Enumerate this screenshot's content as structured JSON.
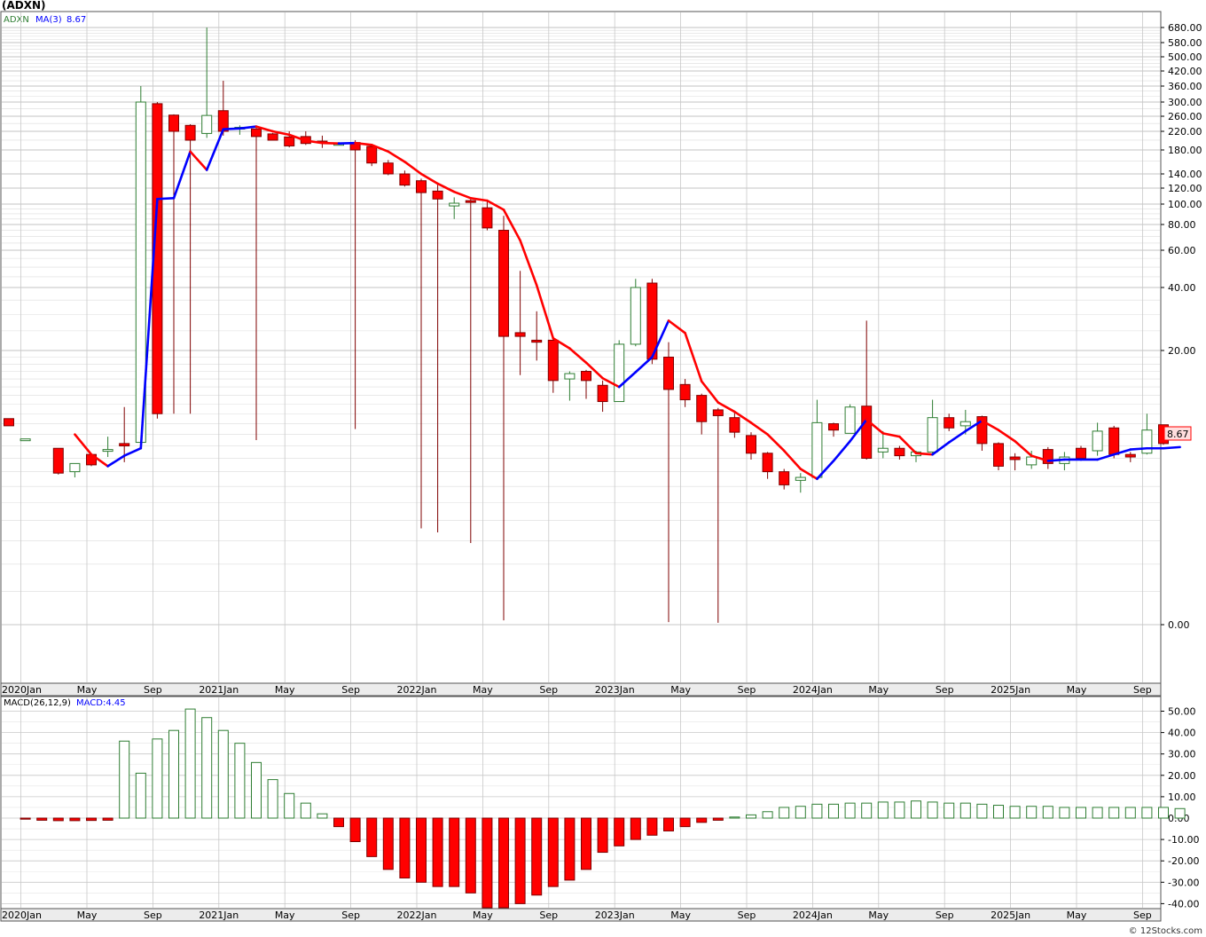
{
  "header": {
    "title": "(ADXN)",
    "legend_symbol": "ADXN",
    "legend_ma": "MA(3)",
    "legend_ma_value": "8.67",
    "last_price_label": "8.67",
    "macd_label": "MACD(26,12,9)",
    "macd_value_label": "MACD:4.45",
    "footer": "© 12Stocks.com"
  },
  "colors": {
    "up": "#2e7d32",
    "down": "#ff0000",
    "down_outline": "#7f0000",
    "ma_up": "#0000ff",
    "ma_down": "#ff0000",
    "grid": "#c8c8c8",
    "axis_bg": "#ececec"
  },
  "chart_data": [
    {
      "type": "candlestick",
      "title": "(ADXN)",
      "y_scale": "log",
      "y_tick_labels": [
        "680.00",
        "580.00",
        "500.00",
        "420.00",
        "360.00",
        "300.00",
        "260.00",
        "220.00",
        "180.00",
        "140.00",
        "120.00",
        "100.00",
        "80.00",
        "60.00",
        "40.00",
        "20.00",
        "0.00"
      ],
      "x_tick_labels": [
        "2020Jan",
        "May",
        "Sep",
        "2021Jan",
        "May",
        "Sep",
        "2022Jan",
        "May",
        "Sep",
        "2023Jan",
        "May",
        "Sep",
        "2024Jan",
        "May",
        "Sep",
        "2025Jan",
        "May",
        "Sep"
      ],
      "legend": [
        "ADXN",
        "MA(3)"
      ],
      "last_value": 8.67,
      "candles": [
        {
          "t": "2019-12",
          "o": 11.5,
          "h": 11.5,
          "l": 10.8,
          "c": 10.8
        },
        {
          "t": "2020-01",
          "o": 9.6,
          "h": 9.6,
          "l": 9.6,
          "c": 9.6
        },
        {
          "t": "2020-03",
          "o": 8.8,
          "h": 8.8,
          "l": 6.8,
          "c": 6.9
        },
        {
          "t": "2020-04",
          "o": 7.0,
          "h": 7.5,
          "l": 6.6,
          "c": 7.6
        },
        {
          "t": "2020-05",
          "o": 8.3,
          "h": 8.4,
          "l": 7.4,
          "c": 7.5
        },
        {
          "t": "2020-06",
          "o": 8.6,
          "h": 9.8,
          "l": 8.1,
          "c": 8.7
        },
        {
          "t": "2020-07",
          "o": 9.2,
          "h": 12.7,
          "l": 7.7,
          "c": 9.0
        },
        {
          "t": "2020-08",
          "o": 9.3,
          "h": 360,
          "l": 9.3,
          "c": 300
        },
        {
          "t": "2020-09",
          "o": 295,
          "h": 300,
          "l": 11.5,
          "c": 12.0
        },
        {
          "t": "2020-10",
          "o": 263,
          "h": 265,
          "l": 12.0,
          "c": 220
        },
        {
          "t": "2020-11",
          "o": 235,
          "h": 238,
          "l": 12.0,
          "c": 200
        },
        {
          "t": "2020-12",
          "o": 215,
          "h": 690,
          "l": 205,
          "c": 262
        },
        {
          "t": "2021-01",
          "o": 275,
          "h": 380,
          "l": 210,
          "c": 220
        },
        {
          "t": "2021-02",
          "o": 228,
          "h": 235,
          "l": 212,
          "c": 230
        },
        {
          "t": "2021-03",
          "o": 226,
          "h": 230,
          "l": 9.5,
          "c": 208
        },
        {
          "t": "2021-04",
          "o": 214,
          "h": 216,
          "l": 200,
          "c": 200
        },
        {
          "t": "2021-05",
          "o": 207,
          "h": 220,
          "l": 185,
          "c": 188
        },
        {
          "t": "2021-06",
          "o": 208,
          "h": 220,
          "l": 190,
          "c": 193
        },
        {
          "t": "2021-07",
          "o": 198,
          "h": 210,
          "l": 184,
          "c": 197
        },
        {
          "t": "2021-08",
          "o": 193,
          "h": 196,
          "l": 189,
          "c": 193
        },
        {
          "t": "2021-09",
          "o": 195,
          "h": 200,
          "l": 10.5,
          "c": 180
        },
        {
          "t": "2021-10",
          "o": 187,
          "h": 190,
          "l": 152,
          "c": 157
        },
        {
          "t": "2021-11",
          "o": 157,
          "h": 162,
          "l": 138,
          "c": 140
        },
        {
          "t": "2021-12",
          "o": 140,
          "h": 145,
          "l": 122,
          "c": 124
        },
        {
          "t": "2022-01",
          "o": 130,
          "h": 133,
          "l": 3.6,
          "c": 114
        },
        {
          "t": "2022-02",
          "o": 116,
          "h": 125,
          "l": 3.4,
          "c": 106
        },
        {
          "t": "2022-03",
          "o": 98,
          "h": 108,
          "l": 85,
          "c": 101
        },
        {
          "t": "2022-04",
          "o": 104,
          "h": 107,
          "l": 2.9,
          "c": 103
        },
        {
          "t": "2022-05",
          "o": 96,
          "h": 104,
          "l": 75,
          "c": 77
        },
        {
          "t": "2022-06",
          "o": 75,
          "h": 88,
          "l": 0.12,
          "c": 23.5
        },
        {
          "t": "2022-07",
          "o": 24.5,
          "h": 48,
          "l": 16.5,
          "c": 23.5
        },
        {
          "t": "2022-08",
          "o": 22.5,
          "h": 31,
          "l": 18.5,
          "c": 22.0
        },
        {
          "t": "2022-09",
          "o": 22.5,
          "h": 23.5,
          "l": 14.3,
          "c": 15.8
        },
        {
          "t": "2022-10",
          "o": 16.0,
          "h": 17.0,
          "l": 13.4,
          "c": 16.7
        },
        {
          "t": "2022-11",
          "o": 17.0,
          "h": 17.2,
          "l": 13.6,
          "c": 15.8
        },
        {
          "t": "2022-12",
          "o": 15.2,
          "h": 15.8,
          "l": 12.2,
          "c": 13.3
        },
        {
          "t": "2023-01",
          "o": 13.3,
          "h": 22.5,
          "l": 13.3,
          "c": 21.5
        },
        {
          "t": "2023-02",
          "o": 21.5,
          "h": 44,
          "l": 21.0,
          "c": 40
        },
        {
          "t": "2023-03",
          "o": 42,
          "h": 44,
          "l": 18.0,
          "c": 18.7
        },
        {
          "t": "2023-04",
          "o": 19.0,
          "h": 22,
          "l": 0.07,
          "c": 14.7
        },
        {
          "t": "2023-05",
          "o": 15.3,
          "h": 16.0,
          "l": 12.7,
          "c": 13.5
        },
        {
          "t": "2023-06",
          "o": 14.0,
          "h": 14.2,
          "l": 10.0,
          "c": 11.2
        },
        {
          "t": "2023-07",
          "o": 12.4,
          "h": 12.6,
          "l": 0.05,
          "c": 11.8
        },
        {
          "t": "2023-08",
          "o": 11.6,
          "h": 12.2,
          "l": 9.7,
          "c": 10.2
        },
        {
          "t": "2023-09",
          "o": 9.9,
          "h": 10.2,
          "l": 7.9,
          "c": 8.4
        },
        {
          "t": "2023-10",
          "o": 8.4,
          "h": 8.5,
          "l": 6.5,
          "c": 7.0
        },
        {
          "t": "2023-11",
          "o": 7.0,
          "h": 7.2,
          "l": 5.8,
          "c": 6.1
        },
        {
          "t": "2023-12",
          "o": 6.4,
          "h": 6.9,
          "l": 5.6,
          "c": 6.6
        },
        {
          "t": "2024-01",
          "o": 6.6,
          "h": 13.5,
          "l": 6.6,
          "c": 11.1
        },
        {
          "t": "2024-02",
          "o": 11.0,
          "h": 11.1,
          "l": 9.8,
          "c": 10.4
        },
        {
          "t": "2024-03",
          "o": 10.1,
          "h": 13.0,
          "l": 10.1,
          "c": 12.7
        },
        {
          "t": "2024-04",
          "o": 12.8,
          "h": 28.0,
          "l": 7.9,
          "c": 8.0
        },
        {
          "t": "2024-05",
          "o": 8.5,
          "h": 10.3,
          "l": 8.0,
          "c": 8.8
        },
        {
          "t": "2024-06",
          "o": 8.8,
          "h": 9.0,
          "l": 7.9,
          "c": 8.2
        },
        {
          "t": "2024-07",
          "o": 8.2,
          "h": 8.6,
          "l": 7.7,
          "c": 8.5
        },
        {
          "t": "2024-08",
          "o": 8.5,
          "h": 13.5,
          "l": 8.2,
          "c": 11.6
        },
        {
          "t": "2024-09",
          "o": 11.6,
          "h": 12.0,
          "l": 10.3,
          "c": 10.6
        },
        {
          "t": "2024-10",
          "o": 10.8,
          "h": 12.4,
          "l": 10.0,
          "c": 11.2
        },
        {
          "t": "2024-11",
          "o": 11.7,
          "h": 11.8,
          "l": 8.6,
          "c": 9.2
        },
        {
          "t": "2024-12",
          "o": 9.2,
          "h": 9.3,
          "l": 7.1,
          "c": 7.4
        },
        {
          "t": "2025-01",
          "o": 8.1,
          "h": 8.4,
          "l": 7.1,
          "c": 7.9
        },
        {
          "t": "2025-02",
          "o": 7.5,
          "h": 8.6,
          "l": 7.2,
          "c": 8.1
        },
        {
          "t": "2025-03",
          "o": 8.7,
          "h": 8.9,
          "l": 7.2,
          "c": 7.6
        },
        {
          "t": "2025-04",
          "o": 7.6,
          "h": 8.5,
          "l": 7.1,
          "c": 8.1
        },
        {
          "t": "2025-05",
          "o": 8.8,
          "h": 9.0,
          "l": 7.9,
          "c": 8.0
        },
        {
          "t": "2025-06",
          "o": 8.6,
          "h": 11.1,
          "l": 8.2,
          "c": 10.3
        },
        {
          "t": "2025-07",
          "o": 10.6,
          "h": 10.8,
          "l": 8.0,
          "c": 8.3
        },
        {
          "t": "2025-08",
          "o": 8.3,
          "h": 8.5,
          "l": 7.7,
          "c": 8.1
        },
        {
          "t": "2025-09",
          "o": 8.4,
          "h": 12.0,
          "l": 8.3,
          "c": 10.4
        },
        {
          "t": "2025-10",
          "o": 10.9,
          "h": 10.9,
          "l": 9.1,
          "c": 9.2
        }
      ],
      "ma3": [
        null,
        null,
        10.0,
        8.3,
        7.4,
        8.2,
        8.8,
        106,
        107,
        177,
        146,
        225,
        227,
        232,
        220,
        212,
        199,
        194,
        193,
        194,
        190,
        177,
        159,
        140,
        126,
        115,
        107,
        104,
        94,
        67,
        41,
        23,
        20.5,
        18.2,
        16.1,
        15.0,
        16.9,
        19.0,
        28,
        24.4,
        15.7,
        13.2,
        12.2,
        11.1,
        10.0,
        8.6,
        7.2,
        6.5,
        7.8,
        9.4,
        11.4,
        10.1,
        9.8,
        8.4,
        8.3,
        9.3,
        10.3,
        11.3,
        10.4,
        9.4,
        8.2,
        7.8,
        7.9,
        7.9,
        7.9,
        8.3,
        8.7,
        8.8,
        8.8,
        8.9
      ],
      "macd_histogram": [
        -0.5,
        -1,
        -1.2,
        -1.2,
        -1.1,
        -1,
        36,
        21,
        37,
        41,
        51,
        47,
        41,
        35,
        26,
        18,
        11.5,
        7,
        2,
        -4,
        -11,
        -18,
        -24,
        -28,
        -30,
        -32,
        -32,
        -35,
        -42,
        -43,
        -40,
        -36,
        -32,
        -29,
        -24,
        -16,
        -13,
        -10,
        -8,
        -6,
        -4,
        -2,
        -1,
        0.5,
        1.5,
        3,
        5,
        5.5,
        6.5,
        6.5,
        7,
        7,
        7.5,
        7.5,
        8,
        7.5,
        7,
        7,
        6.5,
        6,
        5.5,
        5.5,
        5.5,
        5,
        5,
        5,
        5,
        5,
        5,
        5,
        4.45
      ]
    },
    {
      "type": "bar",
      "title": "MACD(26,12,9)",
      "y_tick_labels": [
        "50.00",
        "40.00",
        "30.00",
        "20.00",
        "10.00",
        "0.00",
        "-10.00",
        "-20.00",
        "-30.00",
        "-40.00"
      ],
      "x_tick_labels": [
        "2020Jan",
        "May",
        "Sep",
        "2021Jan",
        "May",
        "Sep",
        "2022Jan",
        "May",
        "Sep",
        "2023Jan",
        "May",
        "Sep",
        "2024Jan",
        "May",
        "Sep",
        "2025Jan",
        "May",
        "Sep"
      ]
    }
  ]
}
